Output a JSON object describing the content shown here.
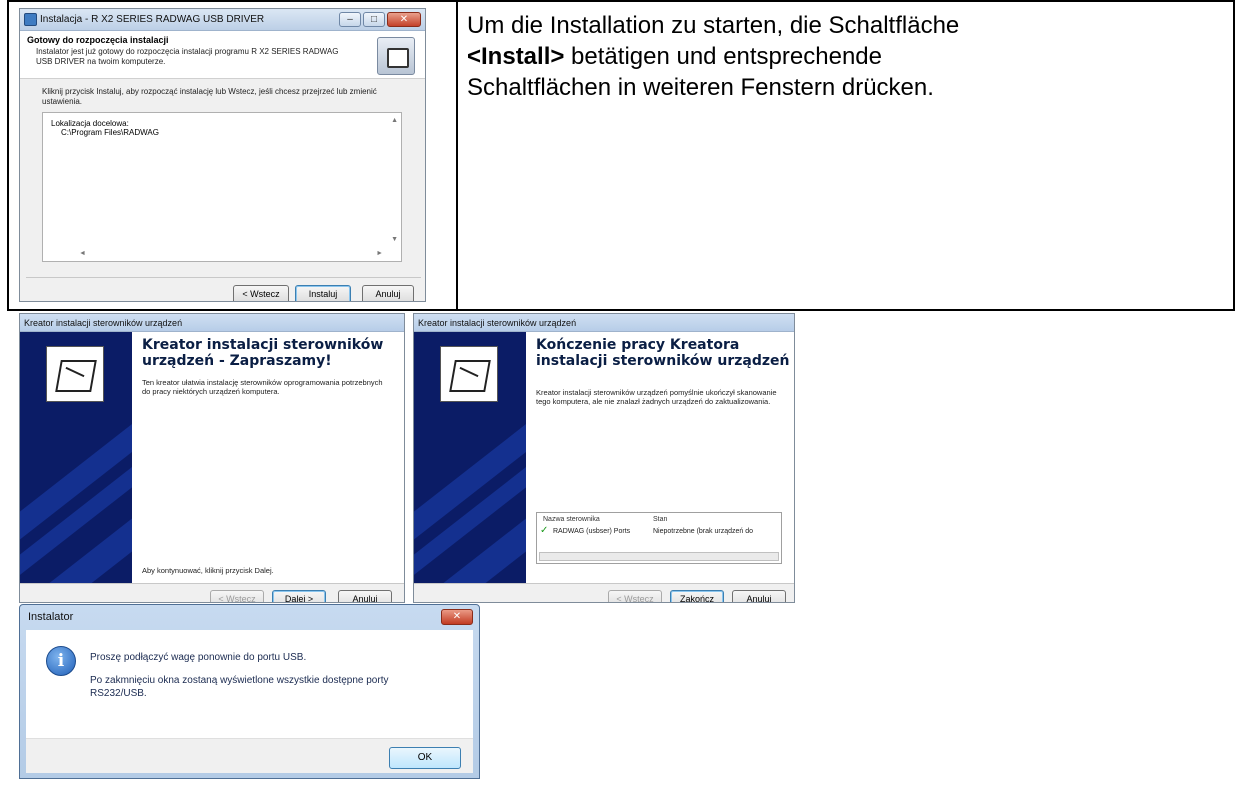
{
  "description": {
    "line1": "Um die Installation zu starten, die Schaltfläche",
    "install_tag": "<Install>",
    "line2_rest": " betätigen und entsprechende",
    "line3": "Schaltflächen in weiteren Fenstern drücken."
  },
  "setup_window": {
    "title": "Instalacja - R X2 SERIES RADWAG USB DRIVER",
    "header_title": "Gotowy do rozpoczęcia instalacji",
    "header_subtitle": "Instalator jest już gotowy do rozpoczęcia instalacji programu R X2 SERIES RADWAG USB DRIVER na twoim komputerze.",
    "body_text": "Kliknij przycisk Instaluj, aby rozpocząć instalację lub Wstecz, jeśli chcesz przejrzeć lub zmienić ustawienia.",
    "memo_label": "Lokalizacja docelowa:",
    "memo_value": "C:\\Program Files\\RADWAG",
    "buttons": {
      "back": "< Wstecz",
      "install": "Instaluj",
      "cancel": "Anuluj"
    }
  },
  "wizard_welcome": {
    "title": "Kreator instalacji sterowników urządzeń",
    "heading": "Kreator instalacji sterowników urządzeń - Zapraszamy!",
    "text": "Ten kreator ułatwia instalację sterowników oprogramowania potrzebnych do pracy niektórych urządzeń komputera.",
    "continue_text": "Aby kontynuować, kliknij przycisk Dalej.",
    "buttons": {
      "back": "< Wstecz",
      "next": "Dalej >",
      "cancel": "Anuluj"
    }
  },
  "wizard_finish": {
    "title": "Kreator instalacji sterowników urządzeń",
    "heading": "Kończenie pracy Kreatora instalacji sterowników urządzeń",
    "text": "Kreator instalacji sterowników urządzeń pomyślnie ukończył skanowanie tego komputera, ale nie znalazł żadnych urządzeń do zaktualizowania.",
    "table": {
      "col_driver": "Nazwa sterownika",
      "col_status": "Stan",
      "row_driver": "RADWAG (usbser) Ports",
      "row_status": "Niepotrzebne (brak urządzeń do"
    },
    "buttons": {
      "back": "< Wstecz",
      "finish": "Zakończ",
      "cancel": "Anuluj"
    }
  },
  "installer_dialog": {
    "title": "Instalator",
    "message1": "Proszę podłączyć wagę ponownie do portu USB.",
    "message2": "Po zakmnięciu okna zostaną wyświetlone wszystkie dostępne porty RS232/USB.",
    "ok": "OK"
  }
}
